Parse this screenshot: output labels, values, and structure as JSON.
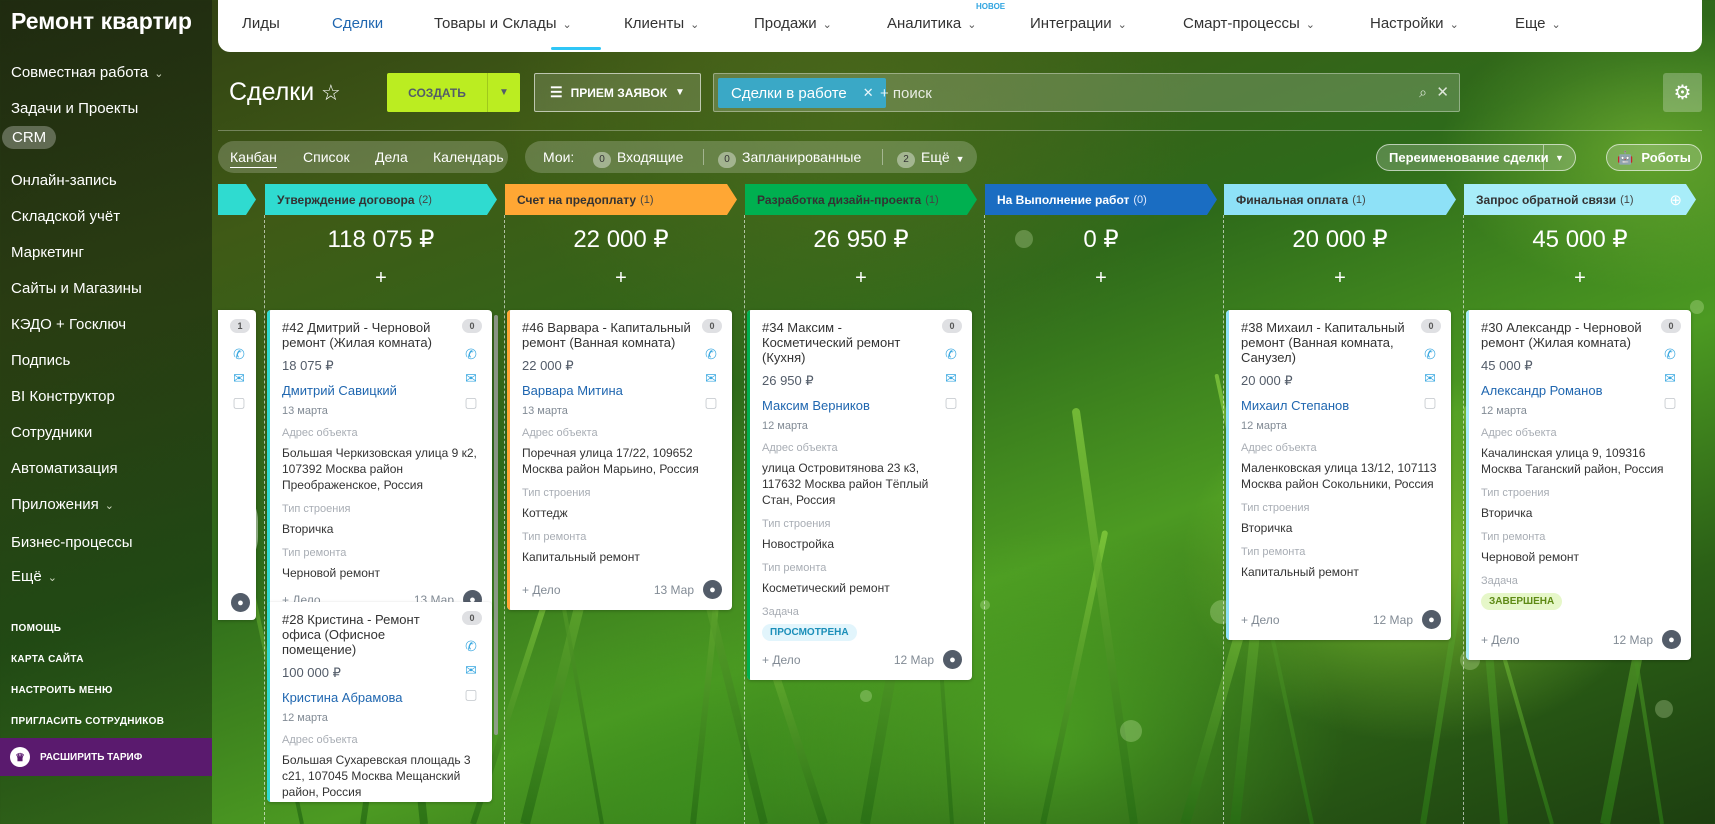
{
  "sidebar": {
    "logo": "Ремонт квартир",
    "items": [
      {
        "label": "Совместная работа",
        "chevron": true
      },
      {
        "label": "Задачи и Проекты"
      },
      {
        "label": "CRM",
        "active": true
      },
      {
        "label": "Онлайн-запись"
      },
      {
        "label": "Складской учёт"
      },
      {
        "label": "Маркетинг"
      },
      {
        "label": "Сайты и Магазины"
      },
      {
        "label": "КЭДО + Госключ"
      },
      {
        "label": "Подпись"
      },
      {
        "label": "BI Конструктор"
      },
      {
        "label": "Сотрудники"
      },
      {
        "label": "Автоматизация"
      },
      {
        "label": "Приложения",
        "chevron": true
      },
      {
        "label": "Бизнес-процессы"
      },
      {
        "label": "Ещё",
        "chevron": true
      }
    ],
    "links": [
      "ПОМОЩЬ",
      "КАРТА САЙТА",
      "НАСТРОИТЬ МЕНЮ",
      "ПРИГЛАСИТЬ СОТРУДНИКОВ"
    ],
    "upgrade": "РАСШИРИТЬ ТАРИФ"
  },
  "topnav": {
    "items": [
      {
        "label": "Лиды"
      },
      {
        "label": "Сделки",
        "active": true
      },
      {
        "label": "Товары и Склады",
        "chevron": true
      },
      {
        "label": "Клиенты",
        "chevron": true
      },
      {
        "label": "Продажи",
        "chevron": true
      },
      {
        "label": "Аналитика",
        "chevron": true
      },
      {
        "label": "Интеграции",
        "chevron": true
      },
      {
        "label": "Смарт-процессы",
        "chevron": true
      },
      {
        "label": "Настройки",
        "chevron": true
      },
      {
        "label": "Еще",
        "chevron": true
      }
    ],
    "new_badge": "НОВОЕ"
  },
  "toolbar": {
    "title": "Сделки",
    "create_label": "СОЗДАТЬ",
    "filter_label": "ПРИЕМ ЗАЯВОК",
    "search_tag": "Сделки в работе",
    "search_placeholder": "+ поиск"
  },
  "views": {
    "items": [
      "Канбан",
      "Список",
      "Дела",
      "Календарь"
    ],
    "mine_label": "Мои:",
    "incoming": {
      "count": "0",
      "label": "Входящие"
    },
    "planned": {
      "count": "0",
      "label": "Запланированные"
    },
    "more": {
      "count": "2",
      "label": "Ещё"
    },
    "rename_label": "Переименование сделки",
    "robots_label": "Роботы"
  },
  "partial_column": {
    "badge": "1"
  },
  "columns": [
    {
      "name": "Утверждение договора",
      "count": "(2)",
      "color": "#2fdbd0",
      "sum": "118 075 ₽",
      "cards": [
        {
          "title": "#42 Дмитрий - Черновой ремонт (Жилая комната)",
          "sum": "18 075 ₽",
          "person": "Дмитрий Савицкий",
          "date": "13 марта",
          "address_label": "Адрес объекта",
          "address": "Большая Черкизовская улица 9 к2, 107392 Москва район Преображенское, Россия",
          "building_label": "Тип строения",
          "building": "Вторичка",
          "repair_label": "Тип ремонта",
          "repair": "Черновой ремонт",
          "add": "+ Дело",
          "foot_date": "13 Мар",
          "badge": "0"
        },
        {
          "title": "#28 Кристина - Ремонт офиса (Офисное помещение)",
          "sum": "100 000 ₽",
          "person": "Кристина Абрамова",
          "date": "12 марта",
          "address_label": "Адрес объекта",
          "address": "Большая Сухаревская площадь 3 с21, 107045 Москва Мещанский район, Россия",
          "badge": "0"
        }
      ]
    },
    {
      "name": "Счет на предоплату",
      "count": "(1)",
      "color": "#ffa734",
      "sum": "22 000 ₽",
      "cards": [
        {
          "title": "#46 Варвара - Капитальный ремонт (Ванная комната)",
          "sum": "22 000 ₽",
          "person": "Варвара Митина",
          "date": "13 марта",
          "address_label": "Адрес объекта",
          "address": "Поречная улица 17/22, 109652 Москва район Марьино, Россия",
          "building_label": "Тип строения",
          "building": "Коттедж",
          "repair_label": "Тип ремонта",
          "repair": "Капитальный ремонт",
          "add": "+ Дело",
          "foot_date": "13 Мар",
          "badge": "0"
        }
      ]
    },
    {
      "name": "Разработка дизайн-проекта",
      "count": "(1)",
      "color": "#00b050",
      "sum": "26 950 ₽",
      "cards": [
        {
          "title": "#34 Максим - Косметический ремонт (Кухня)",
          "sum": "26 950 ₽",
          "person": "Максим Верников",
          "date": "12 марта",
          "address_label": "Адрес объекта",
          "address": "улица Островитянова 23 к3, 117632 Москва район Тёплый Стан, Россия",
          "building_label": "Тип строения",
          "building": "Новостройка",
          "repair_label": "Тип ремонта",
          "repair": "Косметический ремонт",
          "task_label": "Задача",
          "task": "ПРОСМОТРЕНА",
          "add": "+ Дело",
          "foot_date": "12 Мар",
          "badge": "0"
        }
      ]
    },
    {
      "name": "На Выполнение работ",
      "count": "(0)",
      "color": "#1a6dc2",
      "sum": "0 ₽",
      "cards": []
    },
    {
      "name": "Финальная оплата",
      "count": "(1)",
      "color": "#8ee1f7",
      "sum": "20 000 ₽",
      "cards": [
        {
          "title": "#38 Михаил - Капитальный ремонт (Ванная комната, Санузел)",
          "sum": "20 000 ₽",
          "person": "Михаил Степанов",
          "date": "12 марта",
          "address_label": "Адрес объекта",
          "address": "Маленковская улица 13/12, 107113 Москва район Сокольники, Россия",
          "building_label": "Тип строения",
          "building": "Вторичка",
          "repair_label": "Тип ремонта",
          "repair": "Капитальный ремонт",
          "add": "+ Дело",
          "foot_date": "12 Мар",
          "badge": "0"
        }
      ]
    },
    {
      "name": "Запрос обратной связи",
      "count": "(1)",
      "color": "#a8edf9",
      "sum": "45 000 ₽",
      "cards": [
        {
          "title": "#30 Александр - Черновой ремонт (Жилая комната)",
          "sum": "45 000 ₽",
          "person": "Александр Романов",
          "date": "12 марта",
          "address_label": "Адрес объекта",
          "address": "Качалинская улица 9, 109316 Москва Таганский район, Россия",
          "building_label": "Тип строения",
          "building": "Вторичка",
          "repair_label": "Тип ремонта",
          "repair": "Черновой ремонт",
          "task_label": "Задача",
          "task": "ЗАВЕРШЕНА",
          "add": "+ Дело",
          "foot_date": "12 Мар",
          "badge": "0"
        }
      ]
    }
  ]
}
